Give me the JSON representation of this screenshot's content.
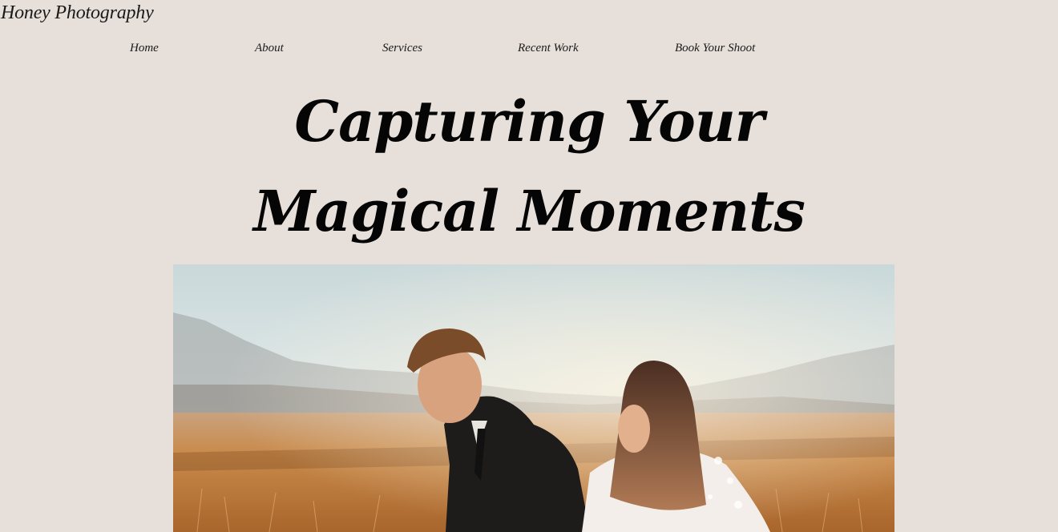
{
  "site": {
    "brand": "Honey Photography"
  },
  "nav": {
    "items": [
      {
        "label": "Home"
      },
      {
        "label": "About"
      },
      {
        "label": "Services"
      },
      {
        "label": "Recent Work"
      },
      {
        "label": "Book Your Shoot"
      }
    ]
  },
  "hero": {
    "title_line1": "Capturing Your",
    "title_line2": "Magical Moments"
  },
  "colors": {
    "background": "#e7e0da",
    "text": "#111111",
    "sky": "#dbe5e6",
    "field": "#c98a4a"
  }
}
